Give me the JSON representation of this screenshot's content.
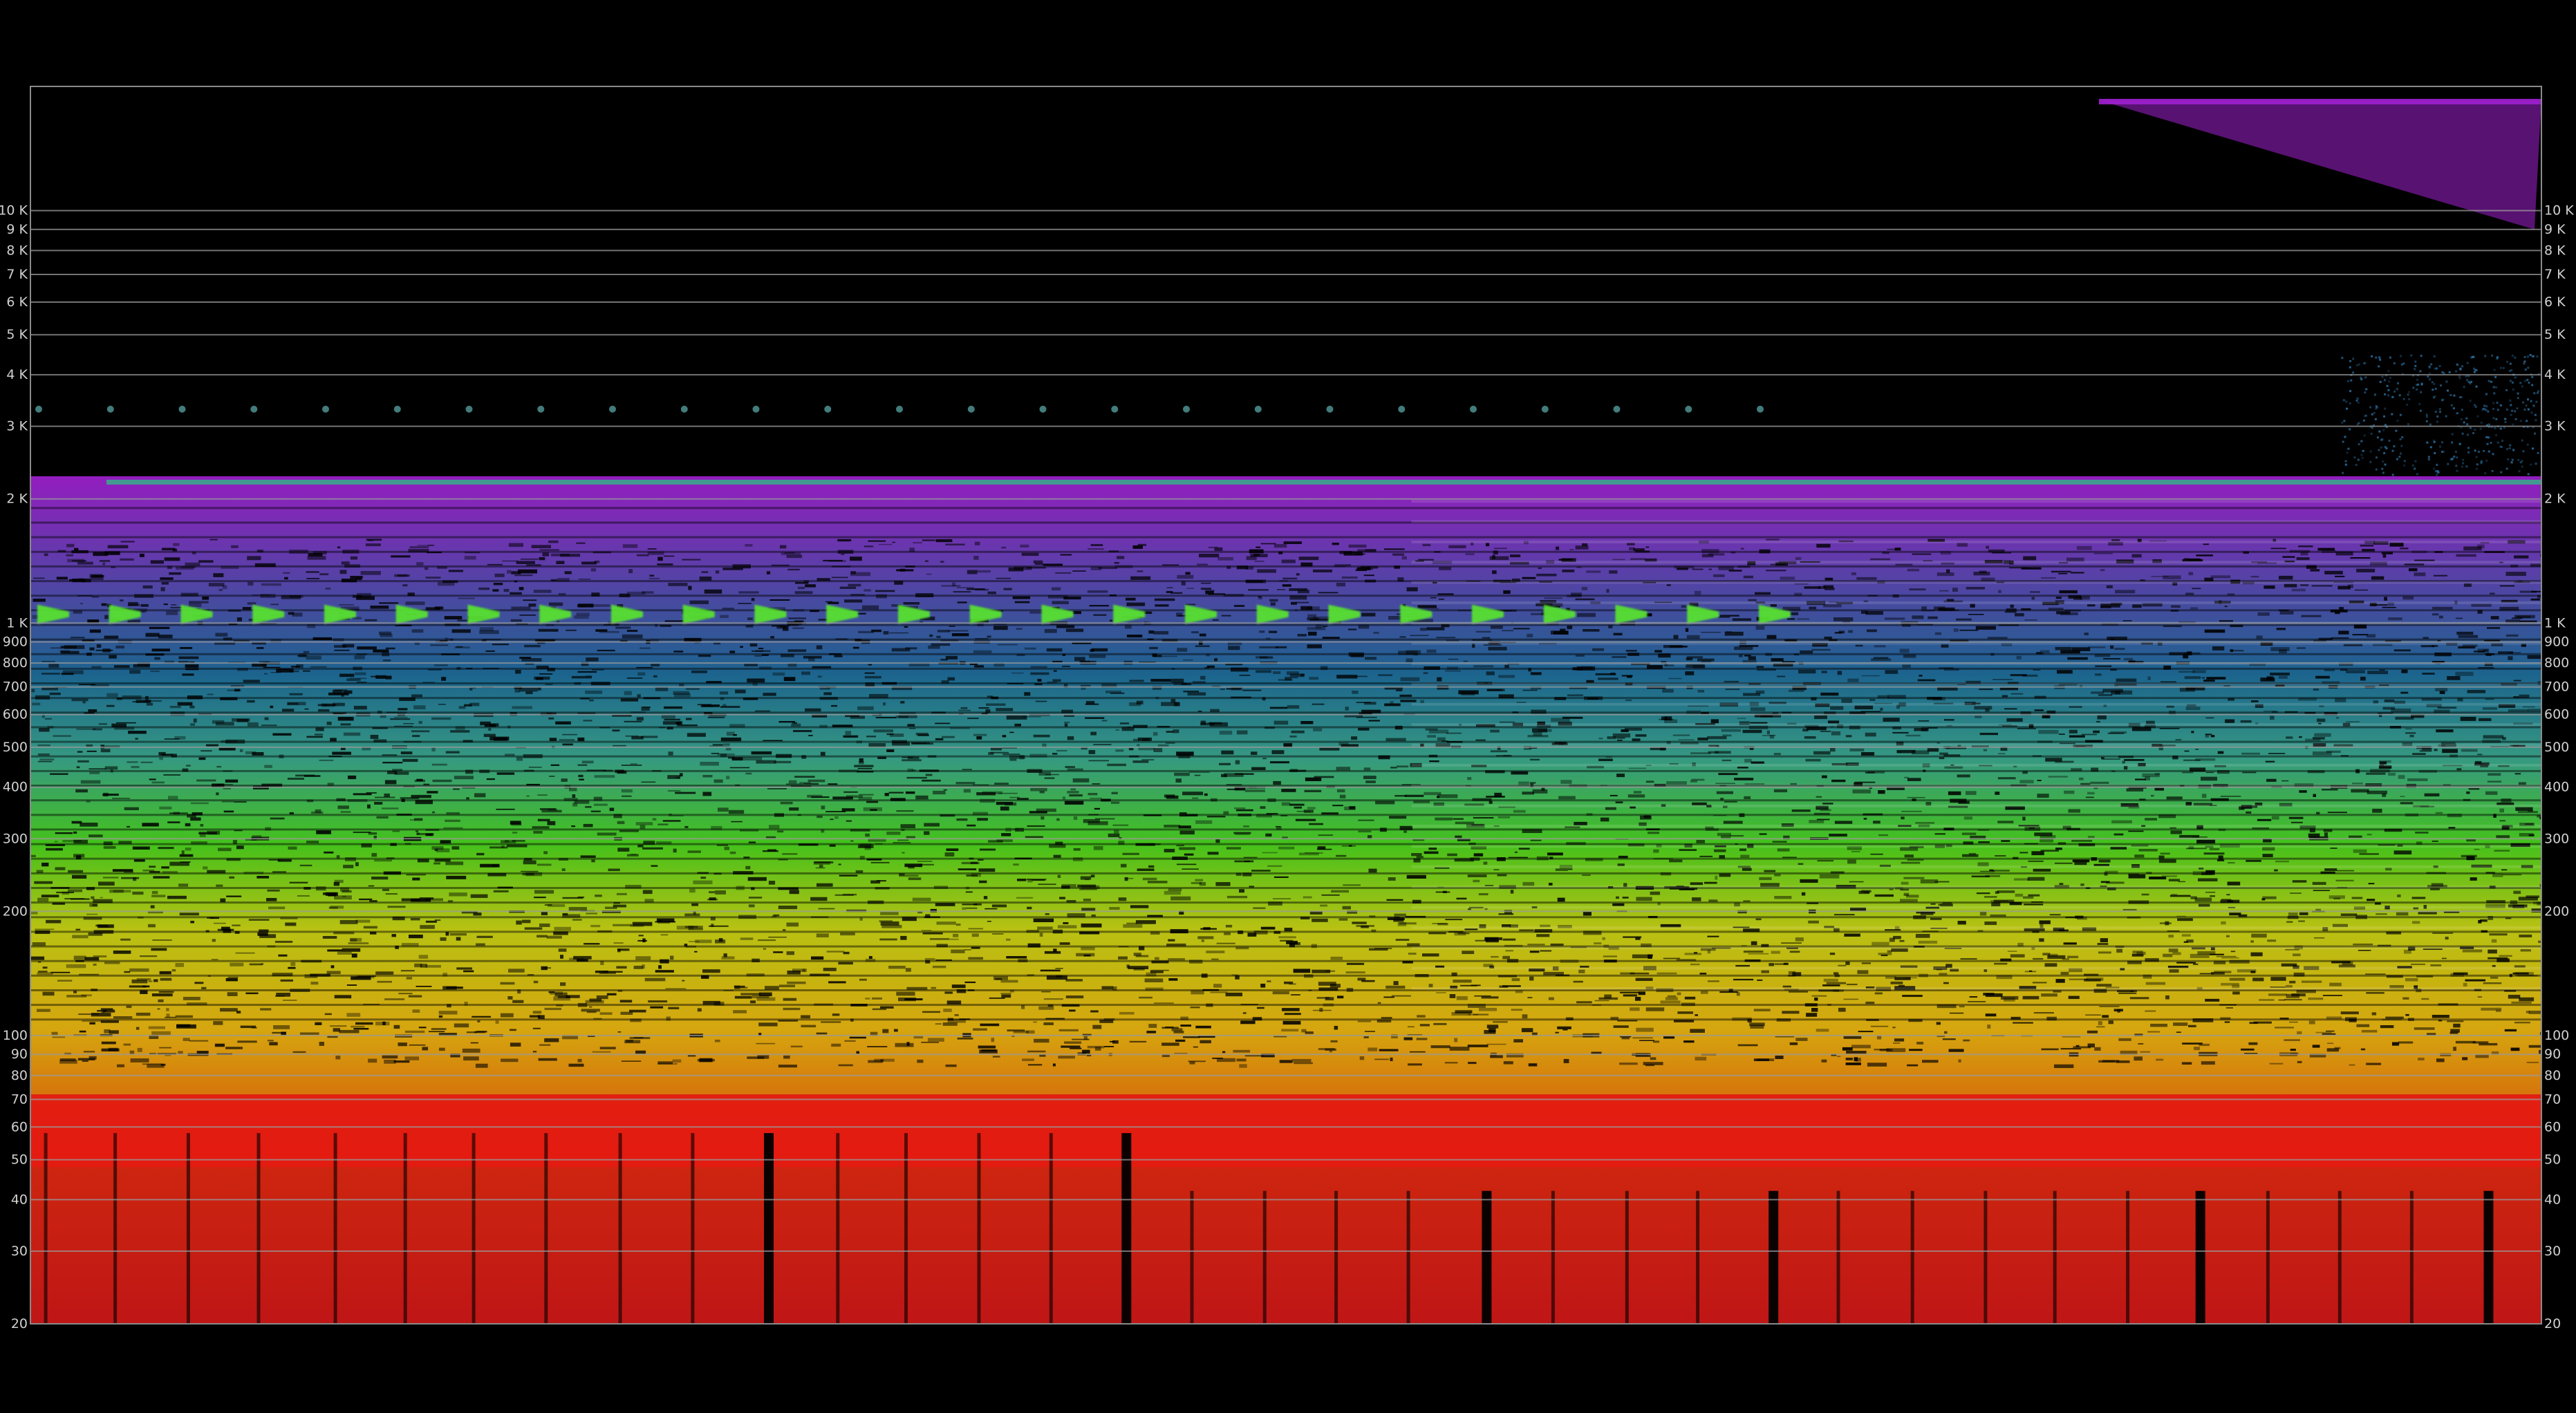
{
  "chart_data": {
    "type": "heatmap",
    "title": "",
    "xlabel": "",
    "ylabel": "",
    "y_scale": "log",
    "ylim": [
      20,
      20000
    ],
    "grid": true,
    "legend": "none",
    "y_ticks": [
      {
        "value": 20,
        "label": "20"
      },
      {
        "value": 30,
        "label": "30"
      },
      {
        "value": 40,
        "label": "40"
      },
      {
        "value": 50,
        "label": "50"
      },
      {
        "value": 60,
        "label": "60"
      },
      {
        "value": 70,
        "label": "70"
      },
      {
        "value": 80,
        "label": "80"
      },
      {
        "value": 90,
        "label": "90"
      },
      {
        "value": 100,
        "label": "100"
      },
      {
        "value": 200,
        "label": "200"
      },
      {
        "value": 300,
        "label": "300"
      },
      {
        "value": 400,
        "label": "400"
      },
      {
        "value": 500,
        "label": "500"
      },
      {
        "value": 600,
        "label": "600"
      },
      {
        "value": 700,
        "label": "700"
      },
      {
        "value": 800,
        "label": "800"
      },
      {
        "value": 900,
        "label": "900"
      },
      {
        "value": 1000,
        "label": "1 K"
      },
      {
        "value": 2000,
        "label": "2 K"
      },
      {
        "value": 3000,
        "label": "3 K"
      },
      {
        "value": 4000,
        "label": "4 K"
      },
      {
        "value": 5000,
        "label": "5 K"
      },
      {
        "value": 6000,
        "label": "6 K"
      },
      {
        "value": 7000,
        "label": "7 K"
      },
      {
        "value": 8000,
        "label": "8 K"
      },
      {
        "value": 9000,
        "label": "9 K"
      },
      {
        "value": 10000,
        "label": "10 K"
      }
    ],
    "colormap_by_frequency": [
      {
        "freq": 20,
        "color": "#d01818"
      },
      {
        "freq": 80,
        "color": "#e02a10"
      },
      {
        "freq": 120,
        "color": "#e8780c"
      },
      {
        "freq": 220,
        "color": "#e8b410"
      },
      {
        "freq": 500,
        "color": "#c8d214"
      },
      {
        "freq": 1000,
        "color": "#4ad21e"
      },
      {
        "freq": 2000,
        "color": "#3aa68c"
      },
      {
        "freq": 4000,
        "color": "#1e6c9a"
      },
      {
        "freq": 20000,
        "color": "#a020d0"
      }
    ],
    "features": {
      "pulse_train": {
        "freq": 1050,
        "count": 25,
        "color": "#58e030"
      },
      "pulse_dots": {
        "freq": 3300,
        "count": 25,
        "color": "#4a8a8a"
      },
      "top_band": {
        "freq": 2200,
        "color": "#3aa68c"
      },
      "high_purple_region": {
        "freq_min": 10000,
        "freq_max": 20000,
        "color": "#a020d0"
      },
      "bass_strong_band": {
        "freq_min": 48,
        "freq_max": 72,
        "color": "#e41a12"
      }
    }
  }
}
